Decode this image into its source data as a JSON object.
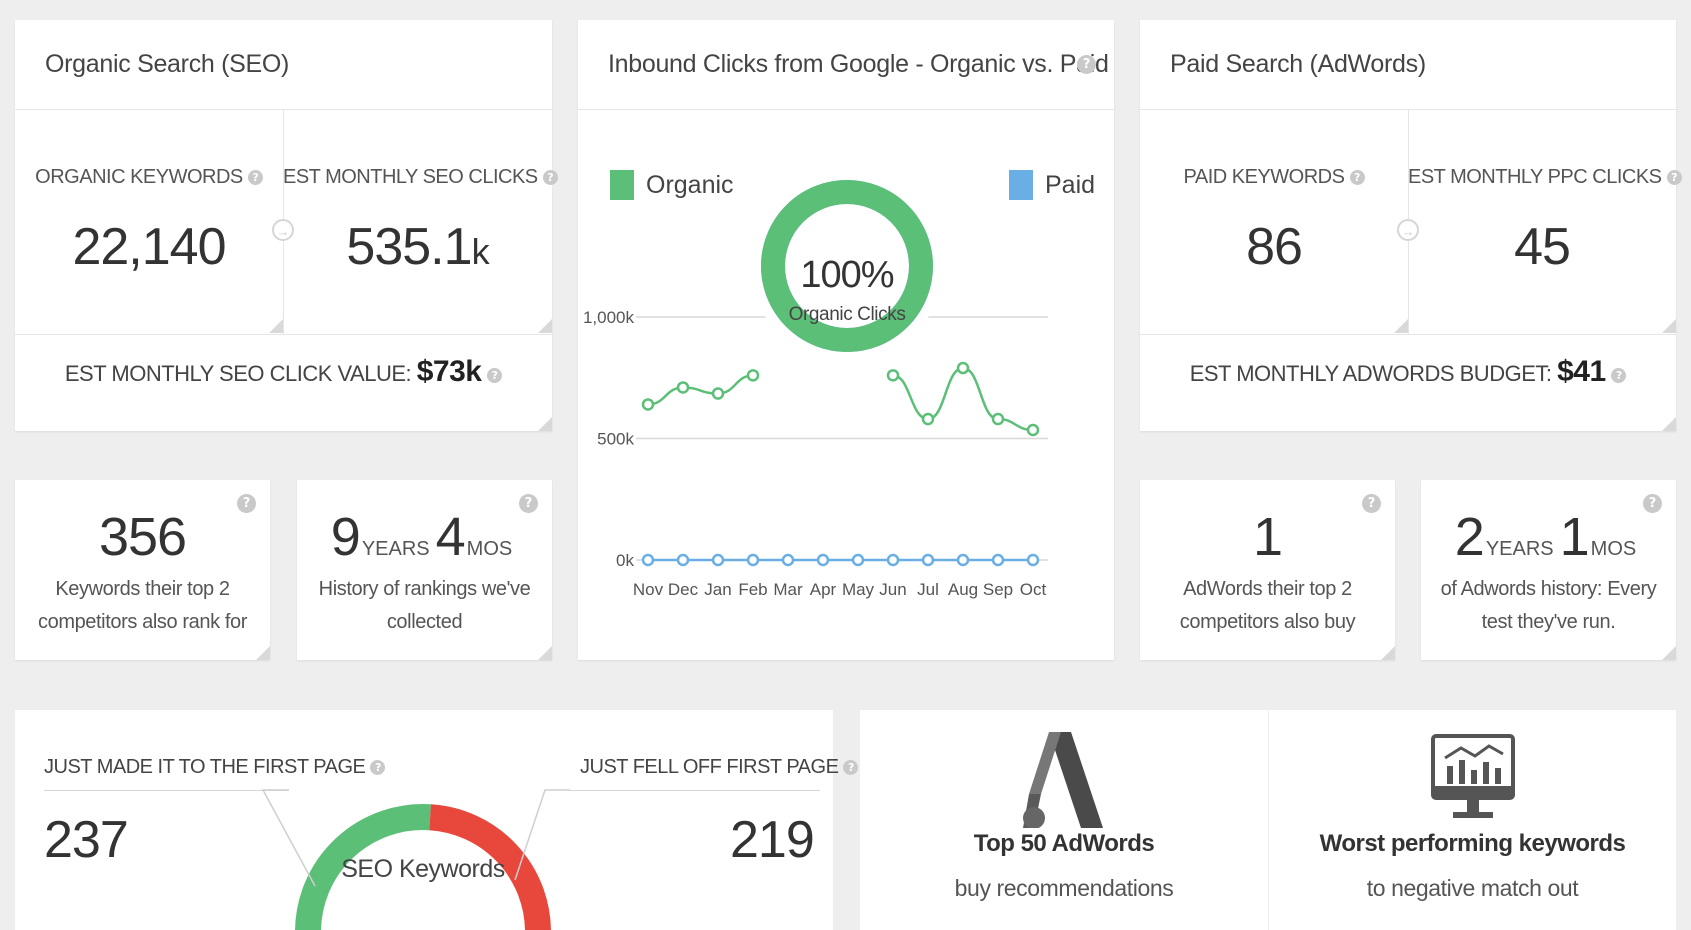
{
  "seo": {
    "title": "Organic Search (SEO)",
    "keywords_label": "ORGANIC KEYWORDS",
    "keywords_value": "22,140",
    "clicks_label": "EST MONTHLY SEO CLICKS",
    "clicks_value": "535.1",
    "clicks_unit": "k",
    "click_value_label": "EST MONTHLY SEO CLICK VALUE:",
    "click_value": "$73k",
    "competitor_keywords_value": "356",
    "competitor_keywords_desc": "Keywords their top 2 competitors also rank for",
    "history_years": "9",
    "history_years_unit": "YEARS",
    "history_months": "4",
    "history_months_unit": "MOS",
    "history_desc": "History of rankings we've collected"
  },
  "chart": {
    "title": "Inbound Clicks from Google - Organic vs. Paid",
    "legend_organic": "Organic",
    "legend_paid": "Paid",
    "donut_value": "100%",
    "donut_label": "Organic Clicks"
  },
  "chart_data": {
    "type": "line",
    "x": [
      "Nov",
      "Dec",
      "Jan",
      "Feb",
      "Mar",
      "Apr",
      "May",
      "Jun",
      "Jul",
      "Aug",
      "Sep",
      "Oct"
    ],
    "y_ticks": [
      "1,000k",
      "500k",
      "0k"
    ],
    "ylim": [
      0,
      1000
    ],
    "series": [
      {
        "name": "Organic",
        "color": "#5cbf78",
        "values": [
          640,
          710,
          685,
          760,
          null,
          null,
          null,
          760,
          580,
          790,
          580,
          535
        ]
      },
      {
        "name": "Paid",
        "color": "#6aaee6",
        "values": [
          0,
          0,
          0,
          0,
          0,
          0,
          0,
          0,
          0,
          0,
          0,
          0
        ]
      }
    ],
    "donut": {
      "organic_percent": 100,
      "paid_percent": 0
    }
  },
  "paid": {
    "title": "Paid Search (AdWords)",
    "keywords_label": "PAID KEYWORDS",
    "keywords_value": "86",
    "clicks_label": "EST MONTHLY PPC CLICKS",
    "clicks_value": "45",
    "budget_label": "EST MONTHLY ADWORDS BUDGET:",
    "budget_value": "$41",
    "competitor_adwords_value": "1",
    "competitor_adwords_desc": "AdWords their top 2 competitors also buy",
    "history_years": "2",
    "history_years_unit": "YEARS",
    "history_months": "1",
    "history_months_unit": "MOS",
    "history_desc": "of Adwords history: Every test they've run."
  },
  "first_page": {
    "made_label": "JUST MADE IT TO THE FIRST PAGE",
    "made_value": "237",
    "fell_label": "JUST FELL OFF FIRST PAGE",
    "fell_value": "219",
    "gauge_label": "SEO Keywords",
    "gauge_made_color": "#5cbf78",
    "gauge_fell_color": "#e8483c"
  },
  "promos": {
    "adwords_title": "Top 50 AdWords",
    "adwords_sub": "buy recommendations",
    "worst_title": "Worst performing keywords",
    "worst_sub": "to negative match out"
  },
  "icons": {
    "help": "?",
    "arrow": "→",
    "adwords_logo": "adwords-logo-icon",
    "monitor_chart": "monitor-chart-icon"
  }
}
